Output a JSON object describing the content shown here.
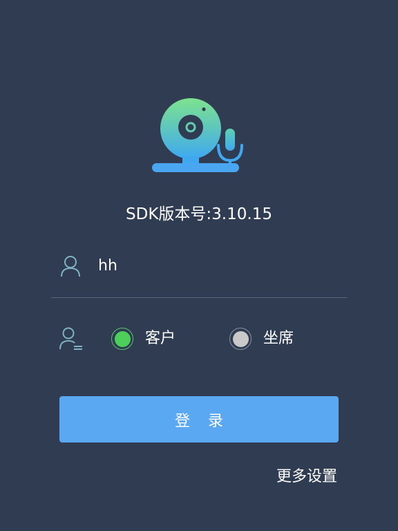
{
  "header": {
    "logo_icon": "webcam-microphone-icon",
    "version_text": "SDK版本号:3.10.15"
  },
  "login_form": {
    "username_icon": "user-icon",
    "username_value": "hh",
    "role_icon": "user-list-icon",
    "roles": [
      {
        "label": "客户",
        "selected": true
      },
      {
        "label": "坐席",
        "selected": false
      }
    ],
    "login_label": "登录",
    "more_settings_label": "更多设置"
  },
  "colors": {
    "background": "#2f3c52",
    "primary_button": "#5aa7f2",
    "selected_radio": "#4cd05a",
    "unselected_radio": "#c9c9c9",
    "icon_gradient_start": "#7de38e",
    "icon_gradient_end": "#3fa8f0"
  }
}
